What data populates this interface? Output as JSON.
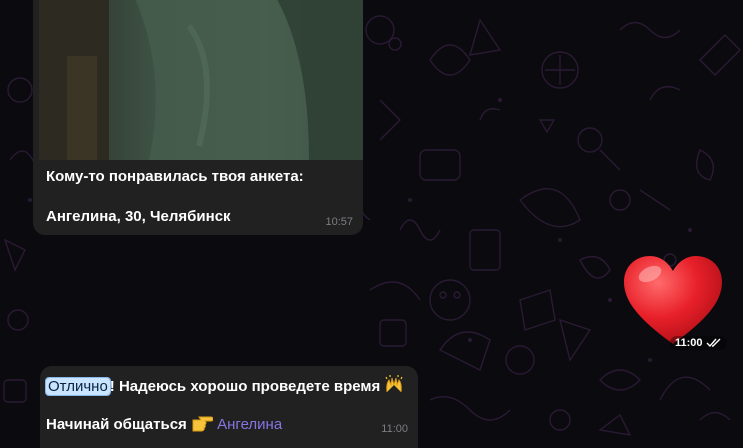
{
  "message_1": {
    "caption_line1": "Кому-то понравилась твоя анкета:",
    "caption_line2": "Ангелина, 30, Челябинск",
    "time": "10:57"
  },
  "sticker": {
    "icon": "red-heart-icon",
    "time": "11:00",
    "status": "double-check-icon"
  },
  "message_2": {
    "highlight": "Отлично",
    "text_rest": "! Надеюсь хорошо проведете время",
    "emoji_1": "raising-hands-icon",
    "line2_text": "Начинай общаться",
    "emoji_2": "pointing-right-icon",
    "mention": "Ангелина",
    "time": "11:00"
  },
  "colors": {
    "background": "#0b0a0e",
    "bubble": "#212121",
    "mention": "#8774e1",
    "highlight": "#c8e4ff",
    "heart": "#e8202a"
  }
}
